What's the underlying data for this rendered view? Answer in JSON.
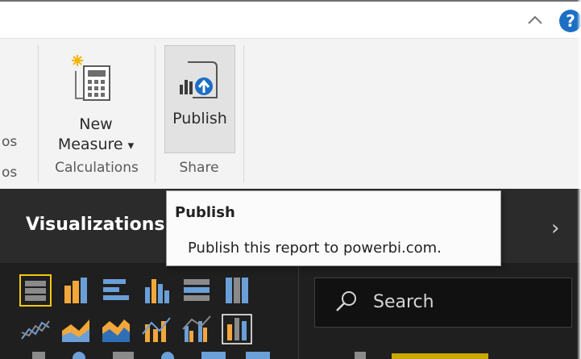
{
  "ribbon": {
    "cut_label_1": "os",
    "cut_label_2": "os",
    "new_measure": {
      "line1": "New",
      "line2": "Measure",
      "dropdown_glyph": "▾",
      "icon": "calculator-icon"
    },
    "publish": {
      "label": "Publish",
      "icon": "publish-report-icon"
    },
    "groups": {
      "calculations": "Calculations",
      "share": "Share"
    }
  },
  "titlebar": {
    "collapse_icon": "chevron-up-icon",
    "help_glyph": "?",
    "help_icon": "help-icon"
  },
  "tooltip": {
    "title": "Publish",
    "body": "Publish this report to powerbi.com."
  },
  "panel": {
    "title": "Visualizations",
    "expand_glyph": "›",
    "search_placeholder": "Search",
    "viz_icons": [
      "stacked-bar-chart-icon",
      "stacked-column-chart-icon",
      "clustered-bar-chart-icon",
      "clustered-column-chart-icon",
      "100-percent-stacked-bar-chart-icon",
      "100-percent-stacked-column-chart-icon",
      "line-chart-icon",
      "area-chart-icon",
      "stacked-area-chart-icon",
      "line-and-column-chart-icon",
      "line-and-clustered-column-chart-icon",
      "ribbon-chart-icon"
    ]
  },
  "colors": {
    "accent_blue": "#1d6fc4",
    "viz_orange": "#f2a73b",
    "viz_blue": "#6a9fd8",
    "selected_border": "#f2c811",
    "dark_panel": "#2b2b2b"
  }
}
